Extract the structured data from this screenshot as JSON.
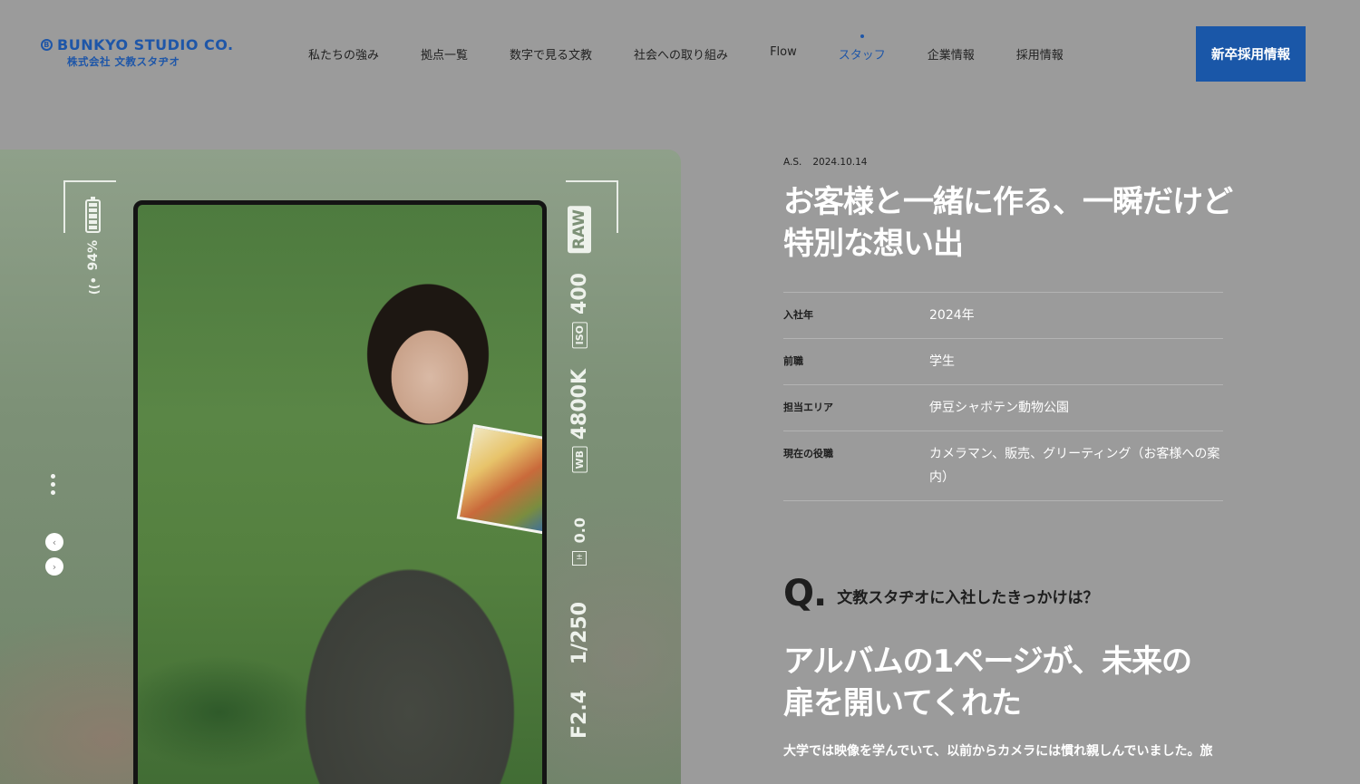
{
  "header": {
    "logo_main": "BUNKYO STUDIO CO.",
    "logo_mark": "B",
    "logo_sub": "株式会社 文教スタヂオ",
    "nav": [
      {
        "label": "私たちの強み",
        "active": false
      },
      {
        "label": "拠点一覧",
        "active": false
      },
      {
        "label": "数字で見る文教",
        "active": false
      },
      {
        "label": "社会への取り組み",
        "active": false
      },
      {
        "label": "Flow",
        "active": false
      },
      {
        "label": "スタッフ",
        "active": true
      },
      {
        "label": "企業情報",
        "active": false
      },
      {
        "label": "採用情報",
        "active": false
      }
    ],
    "cta_label": "新卒採用情報",
    "accent_color": "#1a57a8"
  },
  "camera_overlay": {
    "battery_pct": "94%",
    "raw": "RAW",
    "iso_label": "ISO",
    "iso_value": "400",
    "wb_label": "WB",
    "wb_value": "4800K",
    "exposure": "0.0",
    "shutter": "1/250",
    "aperture": "F2.4"
  },
  "slider": {
    "prev_icon": "chevron-left-icon",
    "next_icon": "chevron-right-icon"
  },
  "article": {
    "author": "A.S.",
    "date": "2024.10.14",
    "headline": "お客様と一緒に作る、一瞬だけど特別な想い出",
    "profile": [
      {
        "label": "入社年",
        "value": "2024年"
      },
      {
        "label": "前職",
        "value": "学生"
      },
      {
        "label": "担当エリア",
        "value": "伊豆シャボテン動物公園"
      },
      {
        "label": "現在の役職",
        "value": "カメラマン、販売、グリーティング（お客様への案内）"
      }
    ],
    "q_mark": "Q.",
    "question": "文教スタヂオに入社したきっかけは？",
    "answer_title": "アルバムの1ページが、未来の扉を開いてくれた",
    "body_start": "大学では映像を学んでいて、以前からカメラには慣れ親しんでいました。旅"
  }
}
